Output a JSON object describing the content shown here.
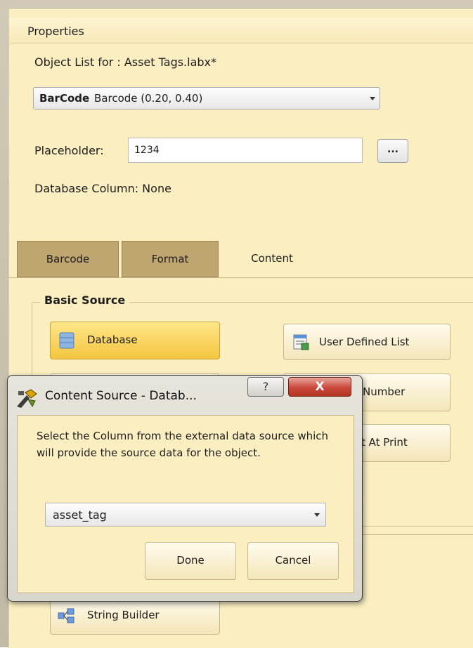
{
  "properties": {
    "title": "Properties",
    "object_list_label": "Object List for :  Asset Tags.labx*",
    "object_select": {
      "name": "BarCode",
      "rest": "Barcode (0.20, 0.40)"
    },
    "placeholder_label": "Placeholder:",
    "placeholder_value": "1234",
    "ellipsis_label": "...",
    "database_column_label": "Database Column: None"
  },
  "tabs": [
    {
      "label": "Barcode",
      "active": false
    },
    {
      "label": "Format",
      "active": false
    },
    {
      "label": "Content",
      "active": true
    }
  ],
  "content": {
    "group_title": "Basic Source",
    "buttons": {
      "database": "Database",
      "user_defined_list": "User Defined List",
      "number_partial": "Number",
      "at_print_partial": "t At Print",
      "string_builder": "String Builder"
    }
  },
  "dialog": {
    "title": "Content Source - Datab...",
    "help_label": "?",
    "close_label": "X",
    "message": "Select the Column from the external data source which will provide the source data for the object.",
    "column_value": "asset_tag",
    "done_label": "Done",
    "cancel_label": "Cancel"
  },
  "colors": {
    "panel_bg": "#fbefc2",
    "tab_inactive": "#bfa56f",
    "database_highlight": "#f4c53e",
    "close_red": "#c9483a"
  }
}
